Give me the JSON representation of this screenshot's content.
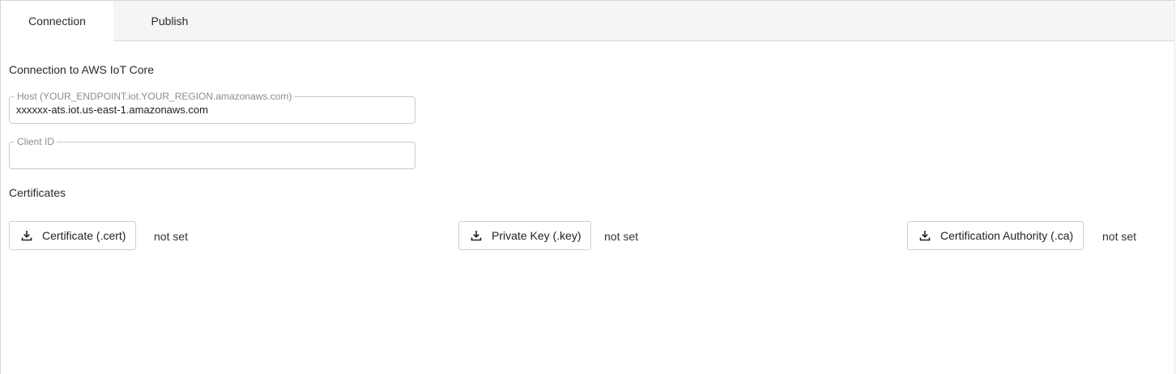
{
  "tabs": [
    {
      "label": "Connection",
      "active": true
    },
    {
      "label": "Publish",
      "active": false
    }
  ],
  "connection": {
    "title": "Connection to AWS IoT Core",
    "host": {
      "label": "Host (YOUR_ENDPOINT.iot.YOUR_REGION.amazonaws.com)",
      "value": "xxxxxx-ats.iot.us-east-1.amazonaws.com"
    },
    "client_id": {
      "label": "Client ID",
      "value": ""
    }
  },
  "certificates": {
    "title": "Certificates",
    "items": [
      {
        "button_label": "Certificate (.cert)",
        "status": "not set",
        "icon": "download-icon"
      },
      {
        "button_label": "Private Key (.key)",
        "status": "not set",
        "icon": "download-icon"
      },
      {
        "button_label": "Certification Authority (.ca)",
        "status": "not set",
        "icon": "download-icon"
      }
    ]
  },
  "colors": {
    "tabbar_background": "#f5f5f5",
    "border": "#c9c9c9",
    "legend_text": "#8c8c8c"
  }
}
